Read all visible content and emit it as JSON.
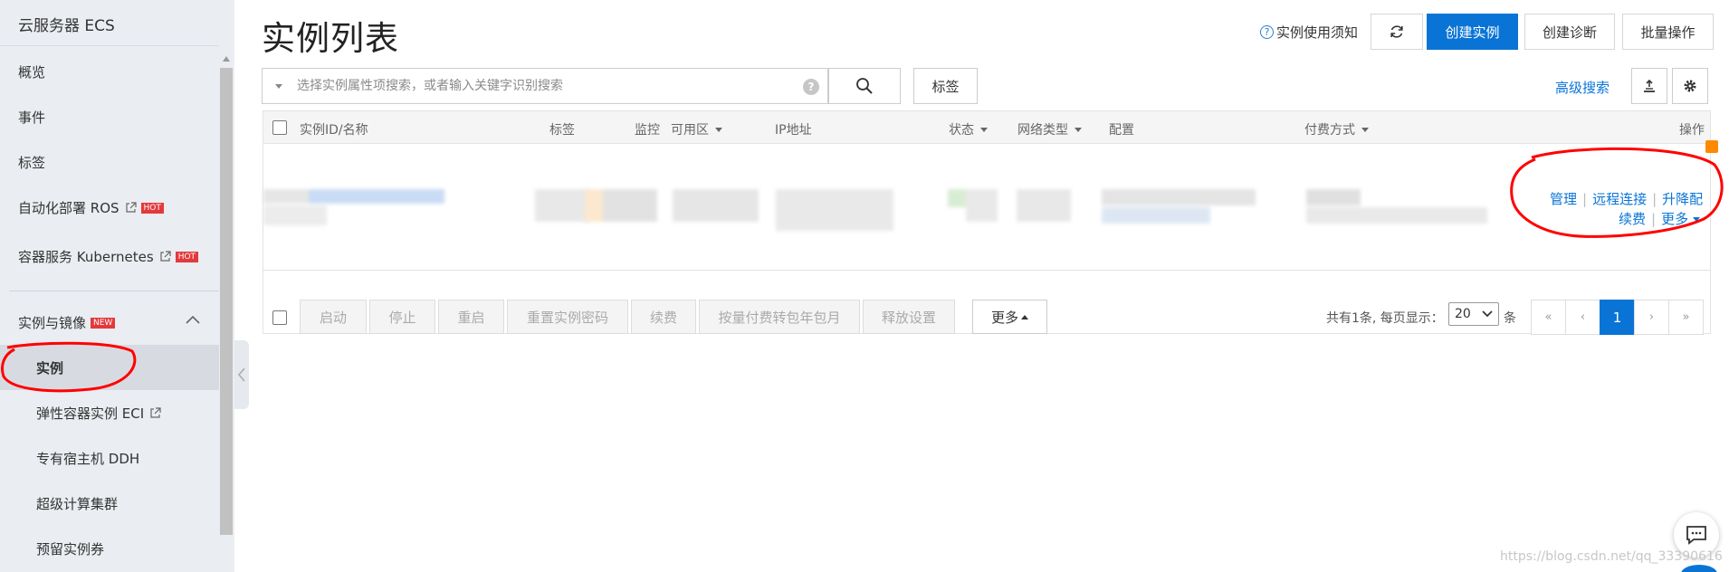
{
  "sidebar": {
    "title": "云服务器 ECS",
    "items": [
      {
        "label": "概览"
      },
      {
        "label": "事件"
      },
      {
        "label": "标签"
      },
      {
        "label": "自动化部署 ROS",
        "badge": "HOT"
      },
      {
        "label": "容器服务 Kubernetes",
        "badge": "HOT"
      }
    ],
    "group": {
      "label": "实例与镜像",
      "badge": "NEW"
    },
    "sub_items": [
      {
        "label": "实例"
      },
      {
        "label": "弹性容器实例 ECI"
      },
      {
        "label": "专有宿主机 DDH"
      },
      {
        "label": "超级计算集群"
      },
      {
        "label": "预留实例券"
      }
    ]
  },
  "header": {
    "title": "实例列表",
    "tips_label": "实例使用须知",
    "create_instance": "创建实例",
    "create_diagnosis": "创建诊断",
    "batch_ops": "批量操作"
  },
  "search": {
    "placeholder": "选择实例属性项搜索，或者输入关键字识别搜索",
    "tag_label": "标签",
    "advanced_label": "高级搜索"
  },
  "table": {
    "columns": {
      "id_name": "实例ID/名称",
      "tags": "标签",
      "monitor": "监控",
      "zone": "可用区",
      "ip": "IP地址",
      "status": "状态",
      "network": "网络类型",
      "config": "配置",
      "billing": "付费方式",
      "actions": "操作"
    },
    "row_actions": {
      "manage": "管理",
      "remote": "远程连接",
      "upgrade": "升降配",
      "renew": "续费",
      "more": "更多"
    }
  },
  "toolbar": {
    "start": "启动",
    "stop": "停止",
    "restart": "重启",
    "reset_pwd": "重置实例密码",
    "renew": "续费",
    "convert": "按量付费转包年包月",
    "release": "释放设置",
    "more": "更多"
  },
  "pagination": {
    "summary": "共有1条, 每页显示：",
    "page_size": "20",
    "unit": "条",
    "first": "«",
    "prev": "‹",
    "current": "1",
    "next": "›",
    "last": "»"
  },
  "watermark": "https://blog.csdn.net/qq_33390616",
  "colors": {
    "primary": "#0a74d6",
    "sidebar_bg": "#eaedf1",
    "badge": "#e4393c",
    "annotation": "#ff0000"
  }
}
